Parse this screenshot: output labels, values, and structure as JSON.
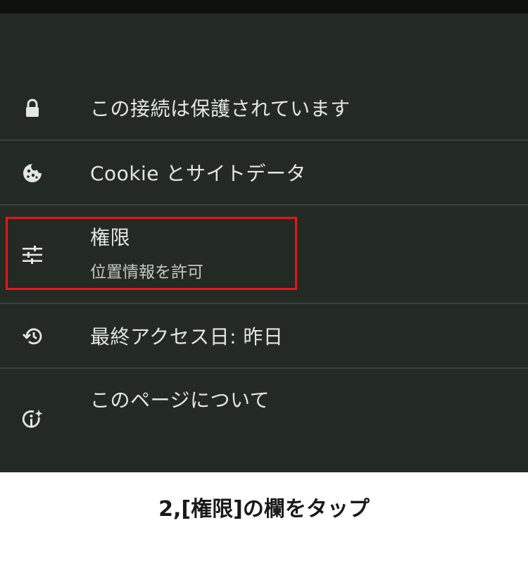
{
  "menu": {
    "connection_label": "この接続は保護されています",
    "cookie_label": "Cookie とサイトデータ",
    "permissions_label": "権限",
    "permissions_sublabel": "位置情報を許可",
    "last_visit_label": "最終アクセス日: 昨日",
    "about_page_label": "このページについて"
  },
  "icons": {
    "connection": "lock-icon",
    "cookie": "cookie-icon",
    "permissions": "tune-sliders-icon",
    "last_visit": "history-icon",
    "about_page": "info-sparkle-icon"
  },
  "annotation": {
    "caption": "2,[権限]の欄をタップ",
    "highlight_color": "#e8141c"
  },
  "colors": {
    "background": "#232a23",
    "text": "#e4e6e1",
    "divider": "#3b423b"
  }
}
